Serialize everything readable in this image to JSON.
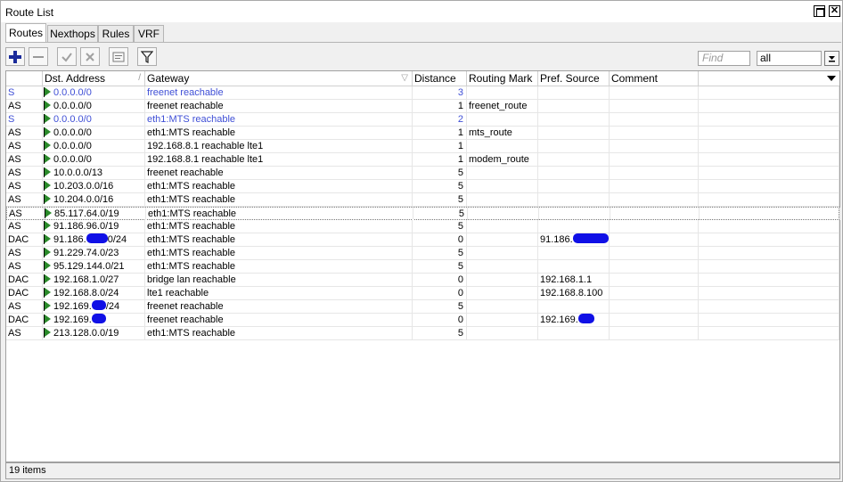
{
  "window": {
    "title": "Route List"
  },
  "tabs": [
    {
      "label": "Routes",
      "active": true
    },
    {
      "label": "Nexthops",
      "active": false
    },
    {
      "label": "Rules",
      "active": false
    },
    {
      "label": "VRF",
      "active": false
    }
  ],
  "toolbar": {
    "buttons": [
      "add-icon",
      "remove-icon",
      "enable-icon",
      "disable-icon",
      "comment-icon",
      "filter-icon"
    ],
    "find_placeholder": "Find",
    "filter_value": "all"
  },
  "table": {
    "columns": [
      "",
      "Dst. Address",
      "Gateway",
      "Distance",
      "Routing Mark",
      "Pref. Source",
      "Comment"
    ],
    "rows": [
      {
        "flags": "S",
        "dst": "0.0.0.0/0",
        "gateway": "freenet reachable",
        "distance": "3",
        "mark": "",
        "pref": "",
        "inactive": true
      },
      {
        "flags": "AS",
        "dst": "0.0.0.0/0",
        "gateway": "freenet reachable",
        "distance": "1",
        "mark": "freenet_route",
        "pref": ""
      },
      {
        "flags": "S",
        "dst": "0.0.0.0/0",
        "gateway": "eth1:MTS reachable",
        "distance": "2",
        "mark": "",
        "pref": "",
        "inactive": true
      },
      {
        "flags": "AS",
        "dst": "0.0.0.0/0",
        "gateway": "eth1:MTS reachable",
        "distance": "1",
        "mark": "mts_route",
        "pref": ""
      },
      {
        "flags": "AS",
        "dst": "0.0.0.0/0",
        "gateway": "192.168.8.1 reachable lte1",
        "distance": "1",
        "mark": "",
        "pref": ""
      },
      {
        "flags": "AS",
        "dst": "0.0.0.0/0",
        "gateway": "192.168.8.1 reachable lte1",
        "distance": "1",
        "mark": "modem_route",
        "pref": ""
      },
      {
        "flags": "AS",
        "dst": "10.0.0.0/13",
        "gateway": "freenet reachable",
        "distance": "5",
        "mark": "",
        "pref": ""
      },
      {
        "flags": "AS",
        "dst": "10.203.0.0/16",
        "gateway": "eth1:MTS reachable",
        "distance": "5",
        "mark": "",
        "pref": ""
      },
      {
        "flags": "AS",
        "dst": "10.204.0.0/16",
        "gateway": "eth1:MTS reachable",
        "distance": "5",
        "mark": "",
        "pref": ""
      },
      {
        "flags": "AS",
        "dst": "85.117.64.0/19",
        "gateway": "eth1:MTS reachable",
        "distance": "5",
        "mark": "",
        "pref": "",
        "selected": true
      },
      {
        "flags": "AS",
        "dst": "91.186.96.0/19",
        "gateway": "eth1:MTS reachable",
        "distance": "5",
        "mark": "",
        "pref": ""
      },
      {
        "flags": "DAC",
        "dst": "91.186.",
        "dst_suffix": "0/24",
        "dst_redact": 24,
        "gateway": "eth1:MTS reachable",
        "distance": "0",
        "mark": "",
        "pref": "91.186.",
        "pref_redact": 40
      },
      {
        "flags": "AS",
        "dst": "91.229.74.0/23",
        "gateway": "eth1:MTS reachable",
        "distance": "5",
        "mark": "",
        "pref": ""
      },
      {
        "flags": "AS",
        "dst": "95.129.144.0/21",
        "gateway": "eth1:MTS reachable",
        "distance": "5",
        "mark": "",
        "pref": ""
      },
      {
        "flags": "DAC",
        "dst": "192.168.1.0/27",
        "gateway": "bridge lan reachable",
        "distance": "0",
        "mark": "",
        "pref": "192.168.1.1"
      },
      {
        "flags": "DAC",
        "dst": "192.168.8.0/24",
        "gateway": "lte1 reachable",
        "distance": "0",
        "mark": "",
        "pref": "192.168.8.100"
      },
      {
        "flags": "AS",
        "dst": "192.169.",
        "dst_suffix": "/24",
        "dst_redact": 16,
        "gateway": "freenet reachable",
        "distance": "5",
        "mark": "",
        "pref": ""
      },
      {
        "flags": "DAC",
        "dst": "192.169.",
        "dst_suffix": "",
        "dst_redact": 16,
        "gateway": "freenet reachable",
        "distance": "0",
        "mark": "",
        "pref": "192.169.",
        "pref_redact": 18
      },
      {
        "flags": "AS",
        "dst": "213.128.0.0/19",
        "gateway": "eth1:MTS reachable",
        "distance": "5",
        "mark": "",
        "pref": ""
      }
    ]
  },
  "status": {
    "items": "19 items"
  },
  "colors": {
    "inactive_text": "#3f4fd6",
    "flag_green": "#2a8a2a",
    "redaction": "#1010e6"
  }
}
